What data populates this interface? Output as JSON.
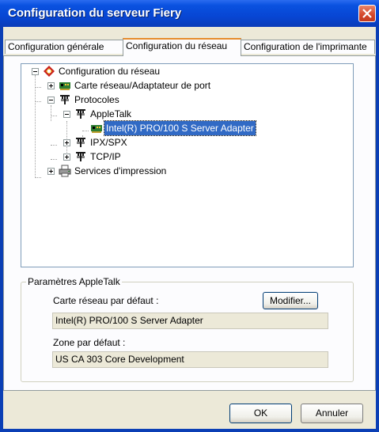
{
  "window": {
    "title": "Configuration du serveur Fiery"
  },
  "tabs": [
    {
      "label": "Configuration générale"
    },
    {
      "label": "Configuration du réseau"
    },
    {
      "label": "Configuration de l'imprimante"
    }
  ],
  "tree": {
    "root": "Configuration du réseau",
    "adapter": "Carte réseau/Adaptateur de port",
    "protocols": "Protocoles",
    "appletalk": "AppleTalk",
    "appletalk_adapter": "Intel(R) PRO/100 S Server Adapter",
    "ipx": "IPX/SPX",
    "tcpip": "TCP/IP",
    "print_services": "Services d'impression"
  },
  "appletalk_settings": {
    "group_title": "Paramètres AppleTalk",
    "default_adapter_label": "Carte réseau par défaut :",
    "modify_label": "Modifier...",
    "default_adapter_value": "Intel(R) PRO/100 S Server Adapter",
    "default_zone_label": "Zone par défaut :",
    "default_zone_value": "US CA 303 Core Development"
  },
  "buttons": {
    "ok": "OK",
    "cancel": "Annuler"
  },
  "icons": {
    "root": "network-config-icon",
    "adapter": "network-card-icon",
    "protocol": "protocol-icon",
    "print_services": "print-services-icon"
  }
}
